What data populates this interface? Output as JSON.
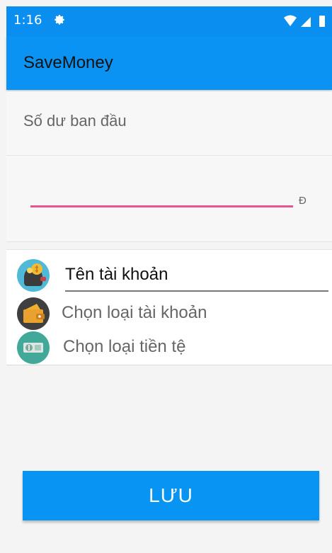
{
  "status_bar": {
    "time": "1:16",
    "settings_icon": "gear-icon",
    "wifi_icon": "wifi-icon",
    "signal_icon": "signal-icon",
    "battery_icon": "battery-icon"
  },
  "appbar": {
    "title": "SaveMoney"
  },
  "balance": {
    "label": "Số dư ban đầu",
    "value": "",
    "currency_symbol": "Đ"
  },
  "account": {
    "name_value": "Tên tài khoản",
    "name_icon": "money-bag-icon",
    "type_label": "Chọn loại tài khoản",
    "type_icon": "wallet-icon",
    "currency_label": "Chọn loại tiền tệ",
    "currency_icon": "banknote-icon"
  },
  "actions": {
    "save_label": "LƯU"
  },
  "colors": {
    "primary": "#0a93f3",
    "input_accent": "#e5558f"
  }
}
